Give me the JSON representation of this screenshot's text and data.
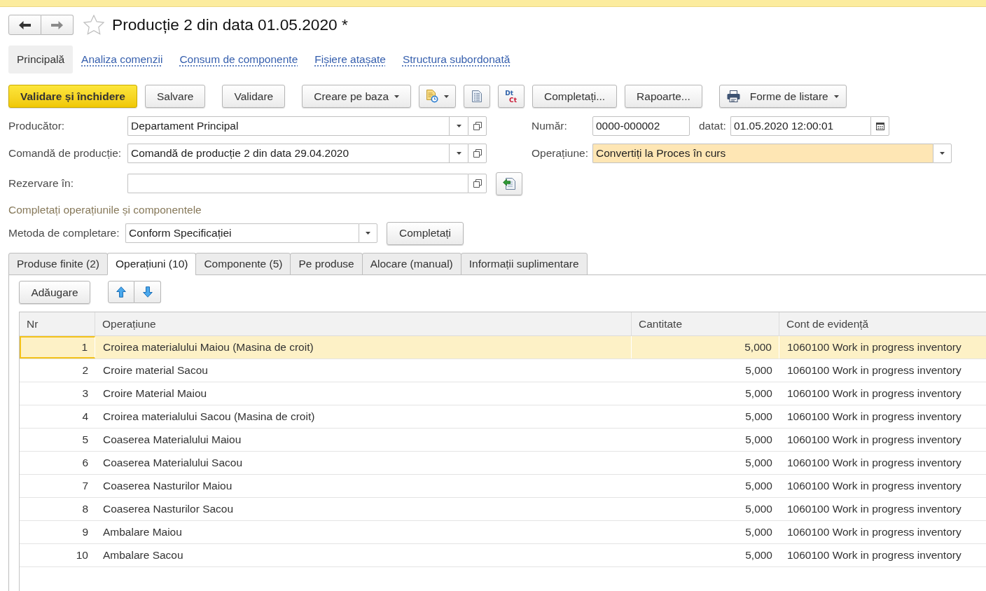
{
  "window": {
    "title": "Producție 2 din data 01.05.2020 *",
    "favorite": false
  },
  "nav_tabs": [
    {
      "label": "Principală",
      "selected": true
    },
    {
      "label": "Analiza comenzii",
      "selected": false
    },
    {
      "label": "Consum de componente",
      "selected": false
    },
    {
      "label": "Fișiere atașate",
      "selected": false
    },
    {
      "label": "Structura subordonată",
      "selected": false
    }
  ],
  "toolbar": {
    "groups": [
      [
        {
          "kind": "text",
          "label": "Validare și închidere",
          "primary": true
        },
        {
          "kind": "text",
          "label": "Salvare",
          "primary": false
        }
      ],
      [
        {
          "kind": "text",
          "label": "Validare",
          "primary": false
        }
      ],
      [
        {
          "kind": "menu",
          "label": "Creare pe baza",
          "primary": false
        },
        {
          "kind": "clock-menu",
          "primary": false
        },
        {
          "kind": "sheet",
          "primary": false
        },
        {
          "kind": "dt-ct",
          "top": "Dt",
          "bottom": "Ct",
          "primary": false
        },
        {
          "kind": "text",
          "label": "Completați...",
          "primary": false
        },
        {
          "kind": "text",
          "label": "Rapoarte...",
          "primary": false
        }
      ],
      [
        {
          "kind": "print-menu",
          "label": "Forme de listare",
          "primary": false
        }
      ]
    ]
  },
  "form": {
    "rows": [
      {
        "left": {
          "label": "Producător:",
          "kind": "select-open",
          "value": "Departament Principal",
          "highlighted": false
        },
        "right": [
          {
            "label": "Număr:",
            "kind": "text",
            "value": "0000-000002",
            "highlighted": false
          },
          {
            "label": "datat:",
            "kind": "date",
            "value": "01.05.2020 12:00:01",
            "highlighted": false
          }
        ]
      },
      {
        "left": {
          "label": "Comandă de producție:",
          "kind": "select-open",
          "value": "Comandă de producție 2 din data 29.04.2020",
          "highlighted": false
        },
        "right": [
          {
            "label": "Operațiune:",
            "kind": "select",
            "value": "Convertiți la Proces în curs",
            "highlighted": true
          }
        ]
      },
      {
        "left": {
          "label": "Rezervare în:",
          "kind": "ref",
          "highlighted": false,
          "action_button": true
        }
      }
    ]
  },
  "fill_section": {
    "title": "Completați operațiunile și componentele",
    "method": {
      "label": "Metoda de completare:",
      "kind": "select",
      "value": "Conform Specificației",
      "highlighted": false
    },
    "button": "Completați"
  },
  "tabs": [
    {
      "label": "Produse finite (2)",
      "selected": false
    },
    {
      "label": "Operațiuni (10)",
      "selected": true
    },
    {
      "label": "Componente (5)",
      "selected": false
    },
    {
      "label": "Pe produse",
      "selected": false
    },
    {
      "label": "Alocare (manual)",
      "selected": false
    },
    {
      "label": "Informații suplimentare",
      "selected": false
    }
  ],
  "table_toolbar": {
    "add_button": "Adăugare"
  },
  "table": {
    "columns": [
      {
        "label": "Nr"
      },
      {
        "label": "Operațiune"
      },
      {
        "label": "Cantitate"
      },
      {
        "label": "Cont de evidență"
      }
    ],
    "rows": [
      {
        "cells": [
          "1",
          "Croirea materialului Maiou (Masina de croit)",
          "5,000",
          "1060100 Work in progress inventory"
        ],
        "selected": true
      },
      {
        "cells": [
          "2",
          "Croire material Sacou",
          "5,000",
          "1060100 Work in progress inventory"
        ],
        "selected": false
      },
      {
        "cells": [
          "3",
          "Croire Material Maiou",
          "5,000",
          "1060100 Work in progress inventory"
        ],
        "selected": false
      },
      {
        "cells": [
          "4",
          "Croirea materialului Sacou (Masina de croit)",
          "5,000",
          "1060100 Work in progress inventory"
        ],
        "selected": false
      },
      {
        "cells": [
          "5",
          "Coaserea Materialului Maiou",
          "5,000",
          "1060100 Work in progress inventory"
        ],
        "selected": false
      },
      {
        "cells": [
          "6",
          "Coaserea Materialului Sacou",
          "5,000",
          "1060100 Work in progress inventory"
        ],
        "selected": false
      },
      {
        "cells": [
          "7",
          "Coaserea Nasturilor Maiou",
          "5,000",
          "1060100 Work in progress inventory"
        ],
        "selected": false
      },
      {
        "cells": [
          "8",
          "Coaserea Nasturilor Sacou",
          "5,000",
          "1060100 Work in progress inventory"
        ],
        "selected": false
      },
      {
        "cells": [
          "9",
          "Ambalare Maiou",
          "5,000",
          "1060100 Work in progress inventory"
        ],
        "selected": false
      },
      {
        "cells": [
          "10",
          "Ambalare Sacou",
          "5,000",
          "1060100 Work in progress inventory"
        ],
        "selected": false
      }
    ]
  }
}
